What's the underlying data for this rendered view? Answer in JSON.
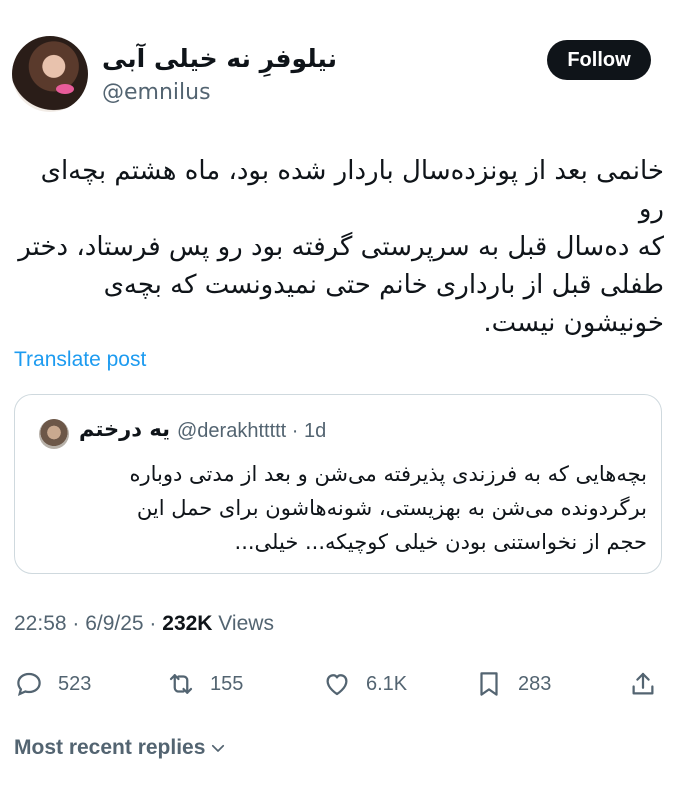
{
  "author": {
    "display_name": "نیلوفرِ نه خیلی آبی",
    "handle": "@emnilus"
  },
  "follow_label": "Follow",
  "tweet": {
    "lines": [
      "خانمی بعد از پونزده‌سال باردار شده بود، ماه هشتم بچه‌ای رو",
      "که ده‌سال قبل به سرپرستی گرفته بود رو پس فرستاد، دختر",
      "طفلی قبل از بارداری خانم حتی نمیدونست که بچه‌ی",
      "خونیشون نیست."
    ]
  },
  "translate_label": "Translate post",
  "quote": {
    "display_name": "یه درختم",
    "meta": "@derakhttttt · 1d",
    "lines": [
      "بچه‌هایی که به فرزندی پذیرفته می‌شن و بعد از مدتی دوباره",
      "برگردونده می‌شن به بهزیستی، شونه‌هاشون برای حمل این",
      "حجم از نخواستنی بودن خیلی کوچیکه... خیلی..."
    ]
  },
  "timestamp": "22:58 · 6/9/25 · ",
  "views_count": "232K",
  "views_label": " Views",
  "actions": {
    "replies": "523",
    "reposts": "155",
    "likes": "6.1K",
    "bookmarks": "283"
  },
  "recent_replies_label": "Most recent replies"
}
